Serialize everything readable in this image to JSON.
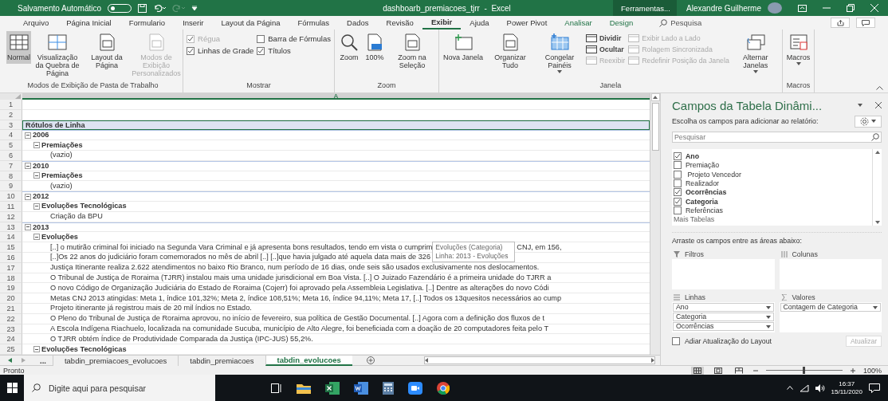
{
  "title_bar": {
    "autosave_label": "Salvamento Automático",
    "autosave_on": false,
    "title": "dashboarb_premiacoes_tjrr  -  Excel",
    "context_label": "Ferramentas...",
    "user": "Alexandre Guilherme"
  },
  "menu_tabs": [
    {
      "label": "Arquivo",
      "selected": false,
      "contextual": false
    },
    {
      "label": "Página Inicial",
      "selected": false,
      "contextual": false
    },
    {
      "label": "Formulario",
      "selected": false,
      "contextual": false
    },
    {
      "label": "Inserir",
      "selected": false,
      "contextual": false
    },
    {
      "label": "Layout da Página",
      "selected": false,
      "contextual": false
    },
    {
      "label": "Fórmulas",
      "selected": false,
      "contextual": false
    },
    {
      "label": "Dados",
      "selected": false,
      "contextual": false
    },
    {
      "label": "Revisão",
      "selected": false,
      "contextual": false
    },
    {
      "label": "Exibir",
      "selected": true,
      "contextual": false
    },
    {
      "label": "Ajuda",
      "selected": false,
      "contextual": false
    },
    {
      "label": "Power Pivot",
      "selected": false,
      "contextual": false
    },
    {
      "label": "Analisar",
      "selected": false,
      "contextual": true
    },
    {
      "label": "Design",
      "selected": false,
      "contextual": true
    }
  ],
  "search": {
    "placeholder": "Pesquisa"
  },
  "ribbon_groups": [
    {
      "label": "Modos de Exibição de Pasta de Trabalho",
      "items": [
        {
          "kind": "large",
          "label": "Normal",
          "selected": true,
          "disabled": false
        },
        {
          "kind": "large",
          "label": "Visualização da Quebra de Página",
          "selected": false,
          "disabled": false
        },
        {
          "kind": "large",
          "label": "Layout da Página",
          "selected": false,
          "disabled": false
        },
        {
          "kind": "large",
          "label": "Modos de Exibição Personalizados",
          "selected": false,
          "disabled": true
        }
      ]
    },
    {
      "label": "Mostrar",
      "items": [
        {
          "kind": "stack",
          "items": [
            {
              "kind": "check",
              "label": "Régua",
              "checked": true,
              "disabled": true
            },
            {
              "kind": "check",
              "label": "Linhas de Grade",
              "checked": true,
              "disabled": false
            }
          ]
        },
        {
          "kind": "stack",
          "items": [
            {
              "kind": "check",
              "label": "Barra de Fórmulas",
              "checked": false,
              "disabled": false
            },
            {
              "kind": "check",
              "label": "Títulos",
              "checked": true,
              "disabled": false
            }
          ]
        }
      ]
    },
    {
      "label": "Zoom",
      "items": [
        {
          "kind": "large",
          "label": "Zoom",
          "disabled": false
        },
        {
          "kind": "large",
          "label": "100%",
          "disabled": false
        },
        {
          "kind": "large",
          "label": "Zoom na Seleção",
          "disabled": false
        }
      ]
    },
    {
      "label": "Janela",
      "items": [
        {
          "kind": "large",
          "label": "Nova Janela",
          "disabled": false
        },
        {
          "kind": "large",
          "label": "Organizar Tudo",
          "disabled": false
        },
        {
          "kind": "large",
          "label": "Congelar Painéis",
          "disabled": false,
          "dropdown": true
        },
        {
          "kind": "stack",
          "items": [
            {
              "kind": "small",
              "label": "Dividir",
              "disabled": false
            },
            {
              "kind": "small",
              "label": "Ocultar",
              "disabled": false
            },
            {
              "kind": "small",
              "label": "Reexibir",
              "disabled": true
            }
          ]
        },
        {
          "kind": "stack",
          "items": [
            {
              "kind": "small",
              "label": "Exibir Lado a Lado",
              "disabled": true
            },
            {
              "kind": "small",
              "label": "Rolagem Sincronizada",
              "disabled": true
            },
            {
              "kind": "small",
              "label": "Redefinir Posição da Janela",
              "disabled": true
            }
          ]
        },
        {
          "kind": "large",
          "label": "Alternar Janelas",
          "disabled": false,
          "dropdown": true
        }
      ]
    },
    {
      "label": "Macros",
      "items": [
        {
          "kind": "large",
          "label": "Macros",
          "disabled": false,
          "dropdown": true
        }
      ]
    }
  ],
  "sheet": {
    "column_header": "A",
    "row_numbers": [
      "1",
      "2",
      "3",
      "4",
      "5",
      "6",
      "7",
      "8",
      "9",
      "10",
      "11",
      "12",
      "13",
      "14",
      "15",
      "16",
      "17",
      "18",
      "19",
      "20",
      "21",
      "22",
      "23",
      "24",
      "25"
    ],
    "header": "Rótulos de Linha",
    "tooltip": {
      "title": "Evoluções (Categoria)",
      "detail": "Linha: 2013 - Evoluções"
    },
    "tree": [
      {
        "label": "2006",
        "expanded": true,
        "children": [
          {
            "label": "Premiações",
            "expanded": true,
            "children": [
              {
                "label": "(vazio)"
              }
            ]
          }
        ]
      },
      {
        "label": "2010",
        "expanded": true,
        "children": [
          {
            "label": "Premiações",
            "expanded": true,
            "children": [
              {
                "label": "(vazio)"
              }
            ]
          }
        ]
      },
      {
        "label": "2012",
        "expanded": true,
        "children": [
          {
            "label": "Evoluções Tecnológicas",
            "expanded": true,
            "children": [
              {
                "label": "Criação da BPU"
              }
            ]
          }
        ]
      },
      {
        "label": "2013",
        "expanded": true,
        "children": [
          {
            "label": "Evoluções",
            "expanded": true,
            "children": [
              {
                "label": "[..] o mutirão criminal foi iniciado na Segunda Vara Criminal e já apresenta bons resultados, tendo em vista o cumprim",
                "label_after": "CNJ, em 156,"
              },
              {
                "label": "[..]Os 22 anos do judiciário foram comemorados no mês de abril [..] [..]que havia julgado até aquela data mais de 326"
              },
              {
                "label": "Justiça Itinerante realiza 2.622 atendimentos no baixo Rio Branco, num período de 16 dias, onde seis são usados exclusivamente nos deslocamentos."
              },
              {
                "label": "O Tribunal de Justiça de Roraima (TJRR) instalou mais uma unidade jurisdicional em Boa Vista. [..] O Juizado Fazendário é a primeira unidade do TJRR a"
              },
              {
                "label": "O novo Código de Organização Judiciária do Estado de Roraima (Cojerr) foi aprovado pela Assembleia Legislativa. [..] Dentre as alterações do novo Códi"
              },
              {
                "label": "Metas CNJ 2013 atingidas: Meta 1, índice 101,32%; Meta 2, índice 108,51%; Meta 16, índice 94,11%; Meta 17, [..] Todos os 13quesitos necessários ao cump"
              },
              {
                "label": "Projeto itinerante já registrou mais de 20 mil índios no Estado."
              },
              {
                "label": "O Pleno do Tribunal de Justiça de Roraima aprovou, no início de fevereiro, sua política de Gestão Documental. [..] Agora com a definição dos fluxos de t"
              },
              {
                "label": "A Escola Indígena Riachuelo, localizada na comunidade Sucuba, município de Alto Alegre, foi beneficiada com a doação de 20 computadores feita pelo T"
              },
              {
                "label": "O TJRR obtém Índice de Produtividade Comparada da Justiça (IPC-JUS) 55,2%."
              }
            ]
          },
          {
            "label": "Evoluções Tecnológicas",
            "expanded": true
          }
        ]
      }
    ]
  },
  "sheet_tabs": {
    "overflow": "...",
    "tabs": [
      {
        "label": "tabdin_premiacoes_evolucoes",
        "selected": false
      },
      {
        "label": "tabdin_premiacoes",
        "selected": false
      },
      {
        "label": "tabdin_evolucoes",
        "selected": true
      }
    ]
  },
  "pivot_pane": {
    "title": "Campos da Tabela Dinâmi...",
    "subtitle": "Escolha os campos para adicionar ao relatório:",
    "search_placeholder": "Pesquisar",
    "fields": [
      {
        "label": "Ano",
        "checked": true
      },
      {
        "label": "Premiação",
        "checked": false
      },
      {
        "label": " Projeto Vencedor",
        "checked": false
      },
      {
        "label": "Realizador",
        "checked": false
      },
      {
        "label": "Ocorrências",
        "checked": true
      },
      {
        "label": "Categoria",
        "checked": true
      },
      {
        "label": "Referências",
        "checked": false
      }
    ],
    "more_tables": "Mais Tabelas",
    "drag_hint": "Arraste os campos entre as áreas abaixo:",
    "areas": [
      {
        "kind": "filters",
        "label": "Filtros"
      },
      {
        "kind": "columns",
        "label": "Colunas"
      },
      {
        "kind": "rows",
        "label": "Linhas",
        "items": [
          "Ano",
          "Categoria",
          "Ocorrências"
        ]
      },
      {
        "kind": "values",
        "label": "Valores",
        "items": [
          "Contagem de Categoria"
        ]
      }
    ],
    "defer_label": "Adiar Atualização do Layout",
    "defer_checked": false,
    "update_button": "Atualizar"
  },
  "status_bar": {
    "status": "Pronto",
    "zoom": {
      "level": 0.5,
      "reading": "100%"
    }
  },
  "taskbar": {
    "search_placeholder": "Digite aqui para pesquisar",
    "time": "16:37",
    "date": "15/11/2020"
  }
}
